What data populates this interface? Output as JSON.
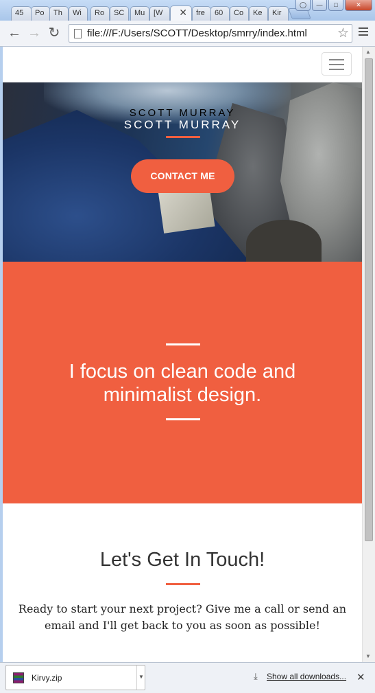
{
  "browser": {
    "tabs": [
      {
        "label": "45"
      },
      {
        "label": "Po"
      },
      {
        "label": "Th"
      },
      {
        "label": "Wi"
      },
      {
        "label": "Ro"
      },
      {
        "label": "SC"
      },
      {
        "label": "Mu"
      },
      {
        "label": "[W"
      },
      {
        "label": "",
        "active": true
      },
      {
        "label": "fre"
      },
      {
        "label": "60"
      },
      {
        "label": "Co"
      },
      {
        "label": "Ke"
      },
      {
        "label": "Kir"
      }
    ],
    "url": "file:///F:/Users/SCOTT/Desktop/smrry/index.html",
    "active_tab_close": "✕"
  },
  "site": {
    "hero": {
      "title_shadow": "SCOTT MURRAY",
      "title": "SCOTT MURRAY",
      "cta_label": "CONTACT ME"
    },
    "about": {
      "text": "I focus on clean code and minimalist design."
    },
    "contact": {
      "heading": "Let's Get In Touch!",
      "text": "Ready to start your next project? Give me a call or send an email and I'll get back to you as soon as possible!"
    }
  },
  "downloads": {
    "file_name": "Kirvy.zip",
    "show_all_label": "Show all downloads...",
    "close_label": "✕"
  },
  "colors": {
    "accent": "#f05f40",
    "browser_frame": "#b6cfee"
  }
}
